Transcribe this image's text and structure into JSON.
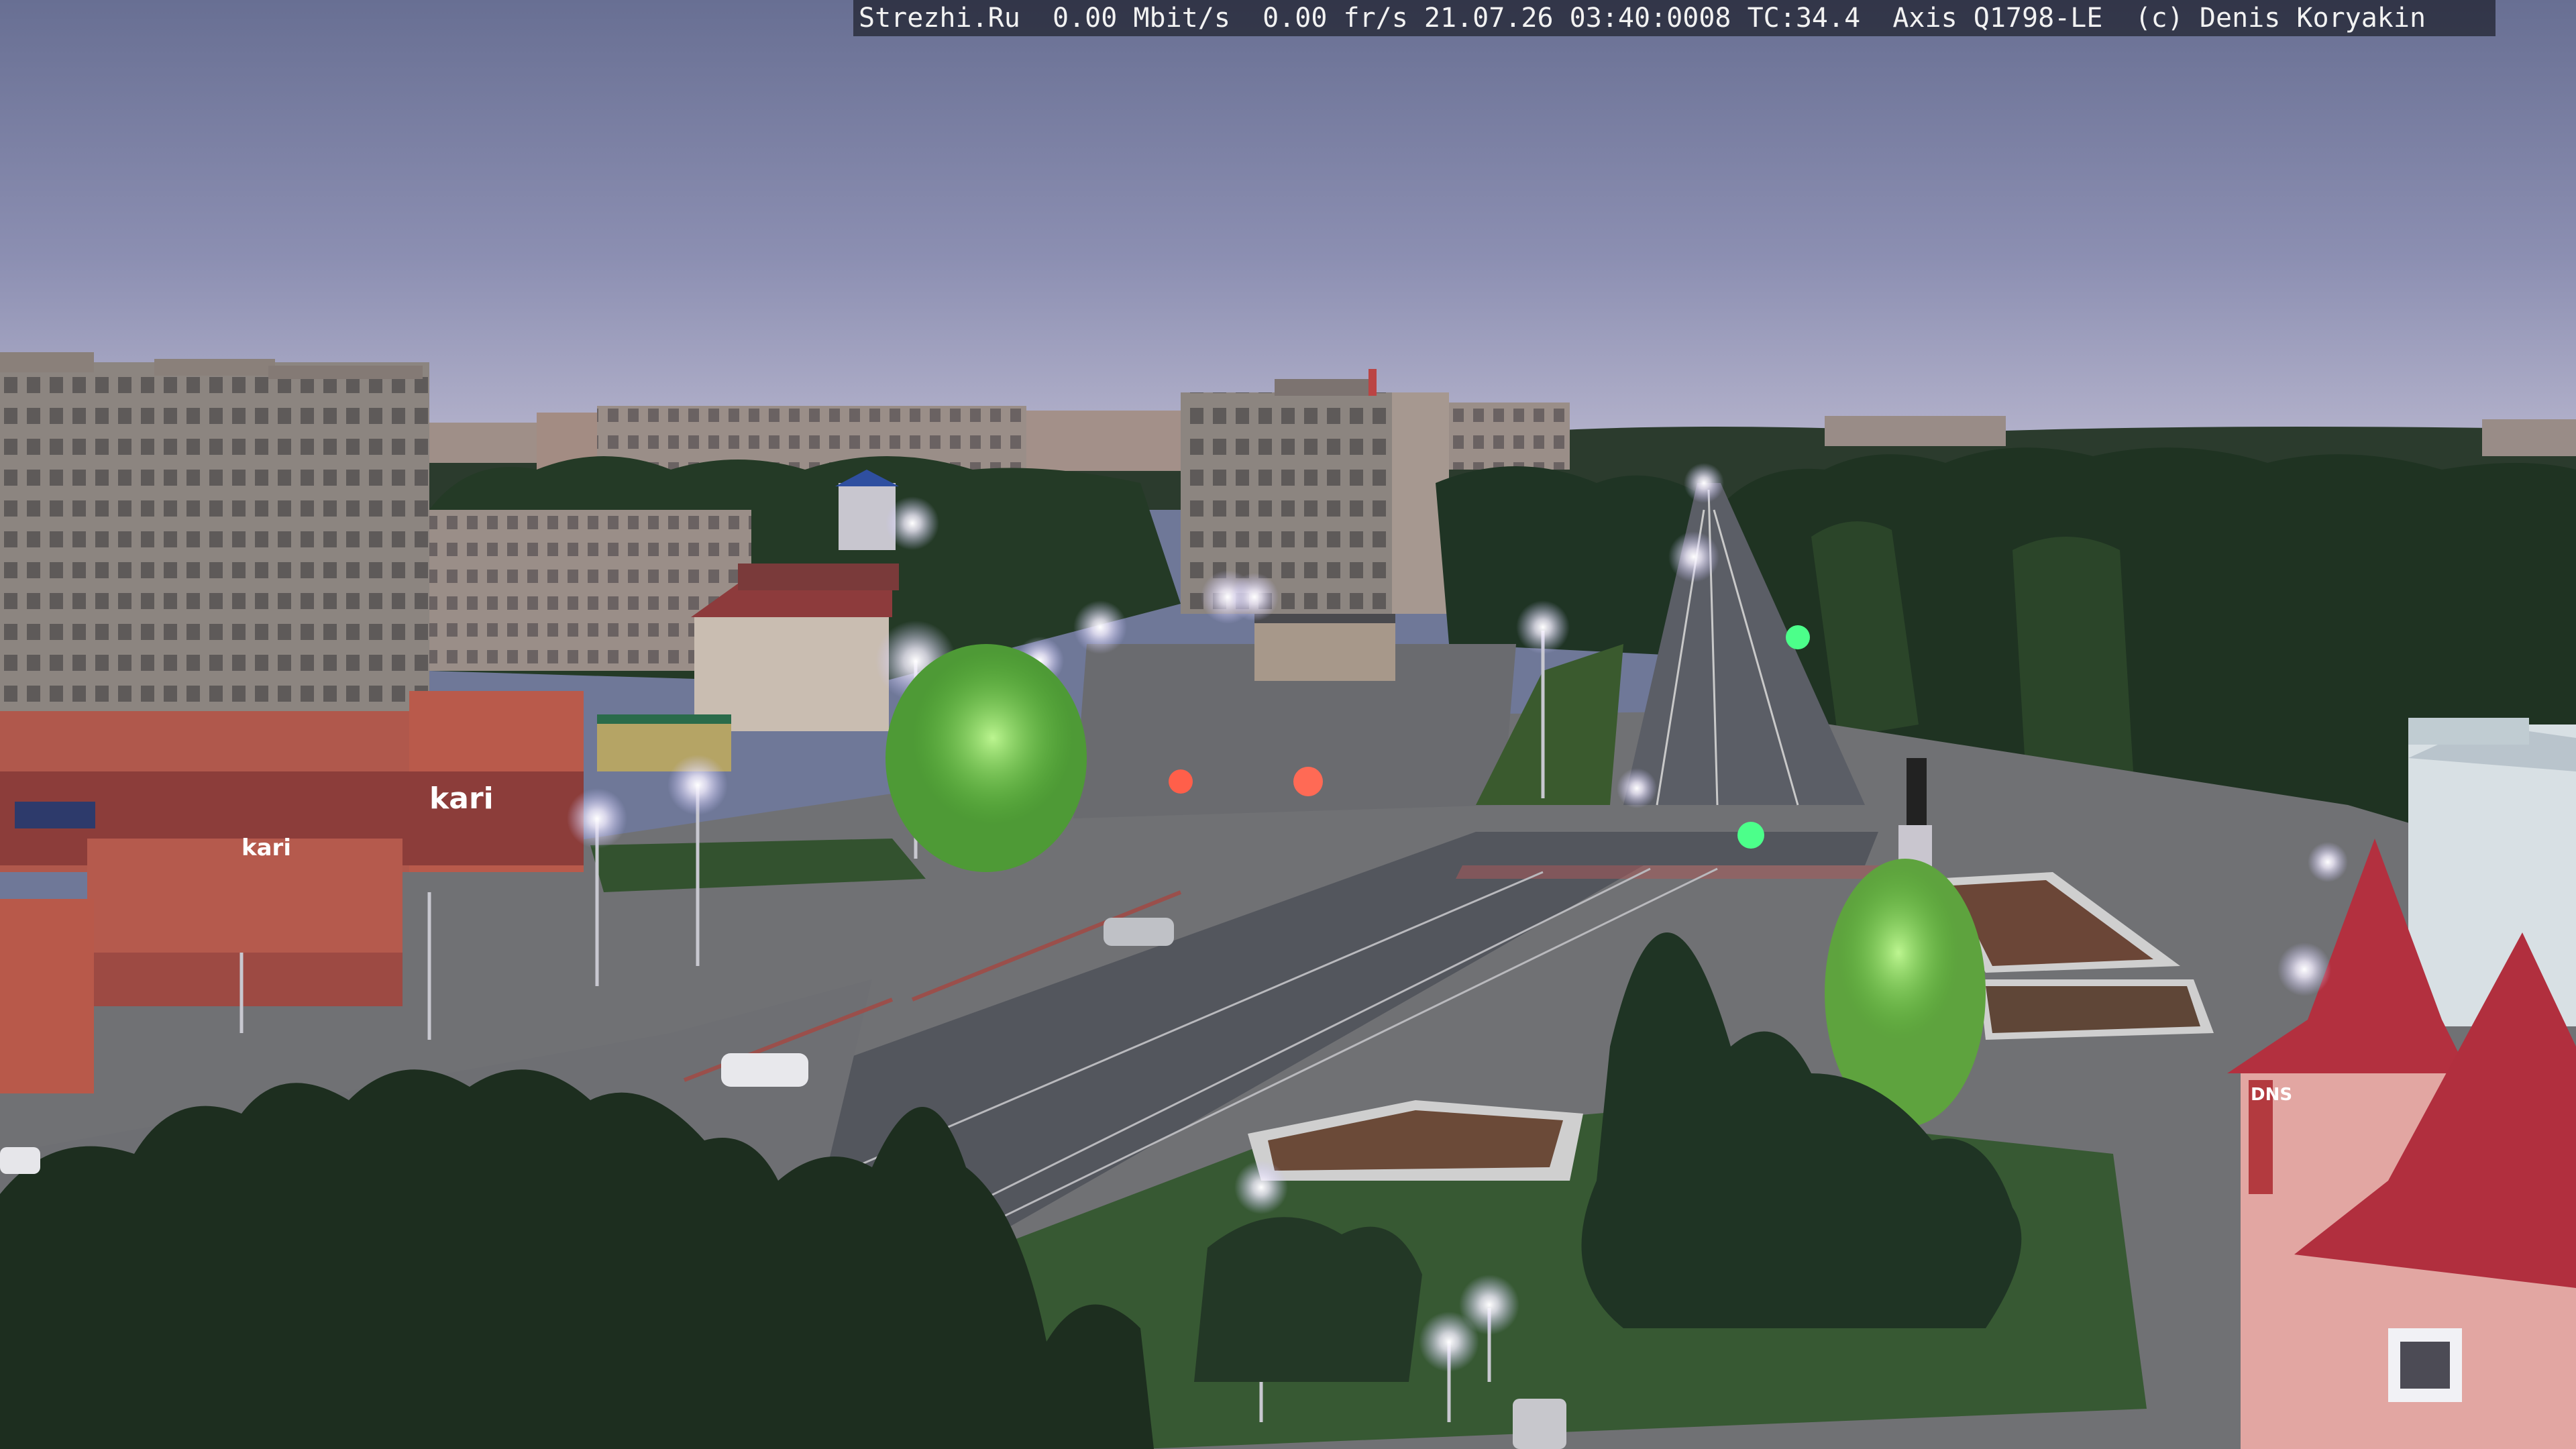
{
  "camera_overlay": {
    "site": "Strezhi.Ru",
    "bitrate": "0.00 Mbit/s",
    "framerate": "0.00 fr/s",
    "timestamp": "21.07.26 03:40:0008",
    "temperature": "TC:34.4",
    "camera_model": "Axis Q1798-LE",
    "copyright": "(c) Denis Koryakin"
  },
  "signage": {
    "store_sign": "kari",
    "store_sign_small": "kari",
    "pharmacy_sign": "DNS"
  },
  "colors": {
    "sky_top": "#6b7295",
    "sky_horizon": "#b6b6cf",
    "tree_dark": "#1f3322",
    "road": "#55585f",
    "building_red": "#b9584a",
    "roof_red": "#b0323f",
    "streetlight": "#f4f0ff"
  }
}
